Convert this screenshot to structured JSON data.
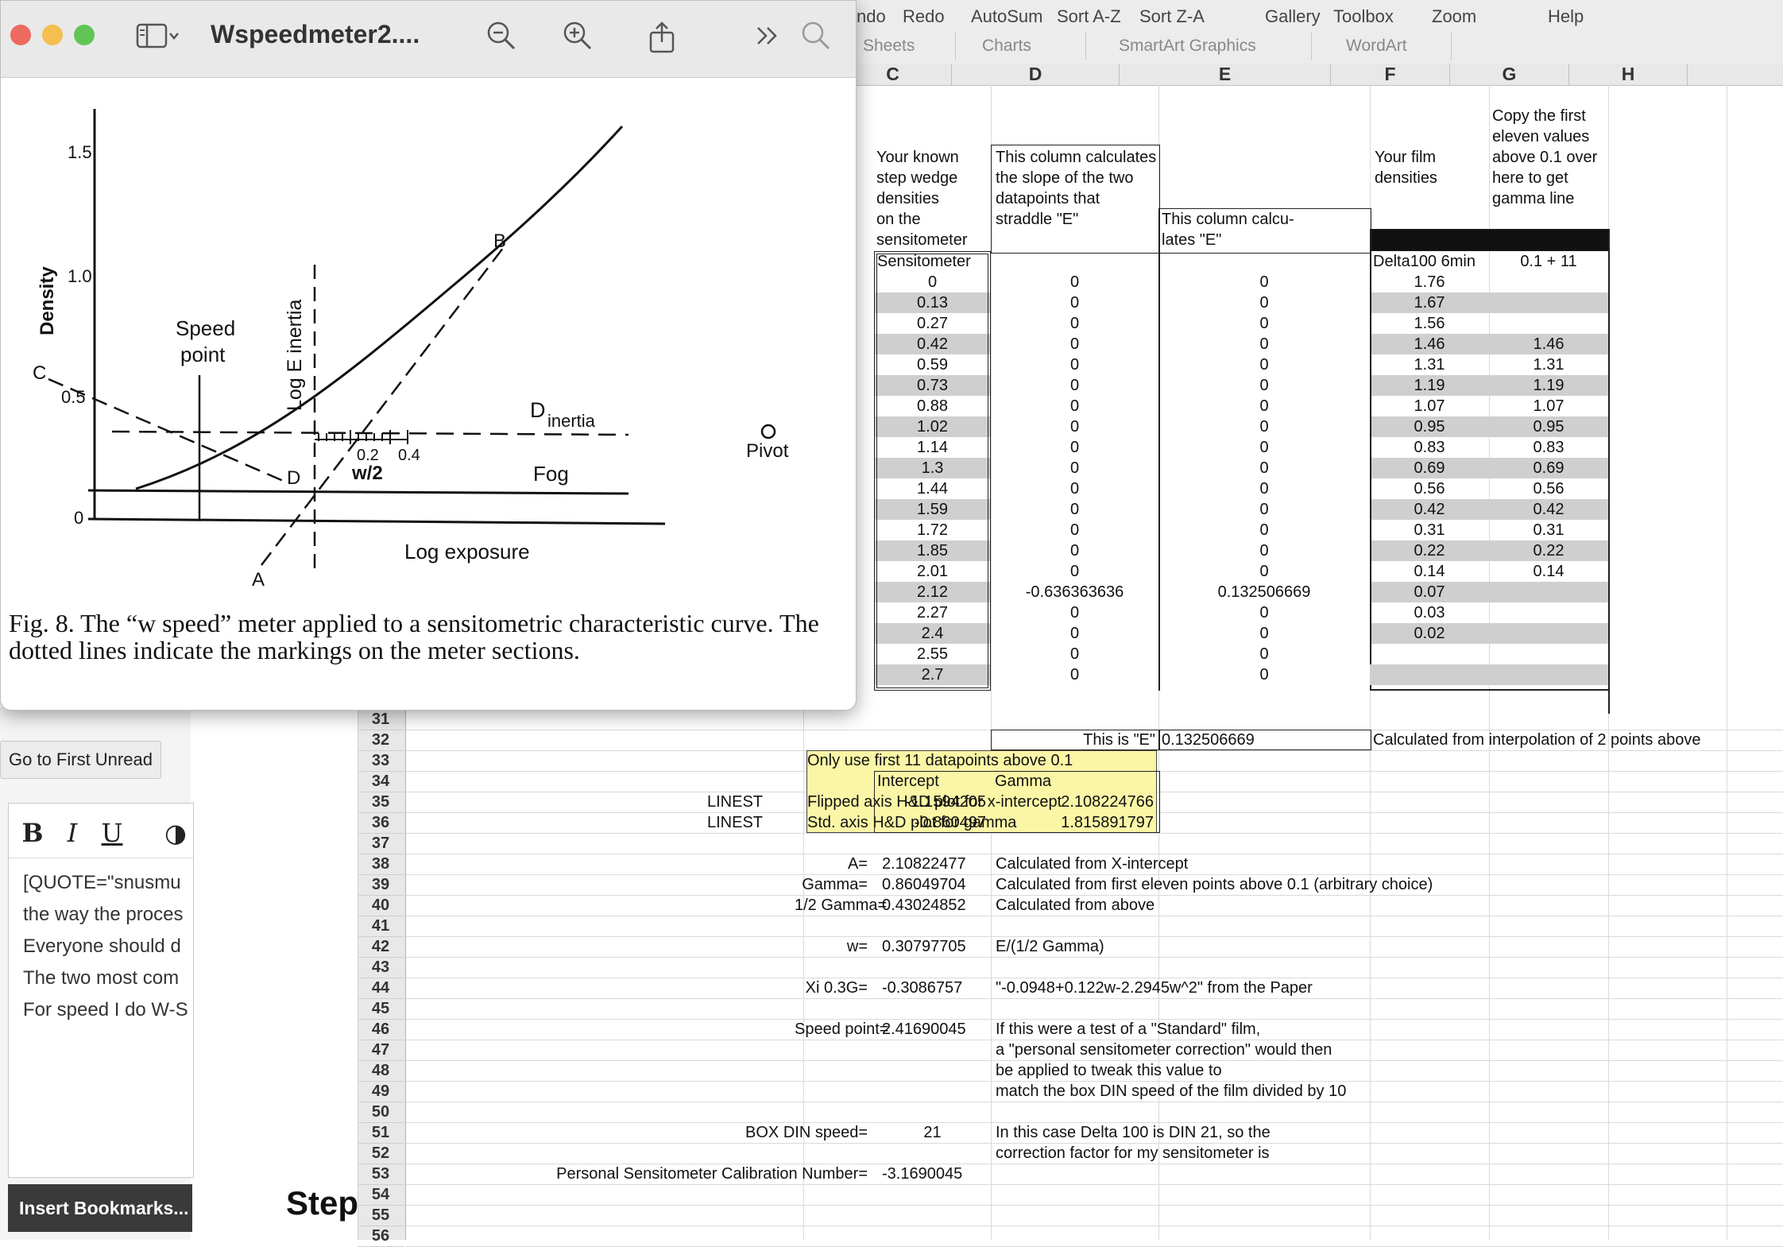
{
  "preview": {
    "title": "Wspeedmeter2....",
    "caption": "Fig. 8. The “w speed” meter applied to a sensitometric characteristic curve. The dotted lines indicate the markings on the meter sections.",
    "figure_labels": {
      "y_axis": "Density",
      "x_axis": "Log exposure",
      "speed_point": [
        "Speed",
        "point"
      ],
      "log_e_inertia": "Log E inertia",
      "d_inertia": "D",
      "d_inertia_sub": "inertia",
      "fog": "Fog",
      "pivot": "Pivot",
      "w_half": "w/2",
      "ticks_y": [
        "1.5",
        "1.0",
        "0.5",
        "0"
      ],
      "scale_ticks": [
        "0.2",
        "0.4"
      ],
      "points": [
        "A",
        "B",
        "C",
        "D"
      ]
    }
  },
  "forum": {
    "go_first_unread": "Go to First Unread",
    "editor_buttons": [
      "B",
      "I",
      "U",
      "◑"
    ],
    "lines": [
      "[QUOTE=\"snusmu",
      "the way the proces",
      "Everyone should d",
      "The two most com",
      "For speed I do W-S"
    ],
    "insert_bookmarks": "Insert Bookmarks...",
    "step": "Step"
  },
  "spreadsheet": {
    "toolbar": [
      "ndo",
      "Redo",
      "AutoSum",
      "Sort A-Z",
      "Sort Z-A",
      "Gallery",
      "Toolbox",
      "Zoom",
      "Help"
    ],
    "ribbon_tabs": [
      "Sheets",
      "Charts",
      "SmartArt Graphics",
      "WordArt"
    ],
    "columns": [
      "C",
      "D",
      "E",
      "F",
      "G",
      "H"
    ],
    "headers": {
      "c": [
        "Your known",
        "step wedge",
        "densities",
        "on the",
        "sensitometer"
      ],
      "d": [
        "This column calculates",
        "the slope of the two",
        "datapoints that",
        "straddle \"E\""
      ],
      "e": [
        "This column calcu-",
        "lates \"E\""
      ],
      "f": [
        "Your film",
        "densities"
      ],
      "g": [
        "Copy the first",
        "eleven values",
        "above 0.1 over",
        "here to get",
        "gamma line"
      ],
      "c_label": "Sensitometer",
      "f_label": "Delta100 6min",
      "g_label": "0.1 + 11"
    },
    "table": {
      "c": [
        "0",
        "0.13",
        "0.27",
        "0.42",
        "0.59",
        "0.73",
        "0.88",
        "1.02",
        "1.14",
        "1.3",
        "1.44",
        "1.59",
        "1.72",
        "1.85",
        "2.01",
        "2.12",
        "2.27",
        "2.4",
        "2.55",
        "2.7"
      ],
      "d": [
        "0",
        "0",
        "0",
        "0",
        "0",
        "0",
        "0",
        "0",
        "0",
        "0",
        "0",
        "0",
        "0",
        "0",
        "0",
        "-0.636363636",
        "0",
        "0",
        "0",
        "0"
      ],
      "e": [
        "0",
        "0",
        "0",
        "0",
        "0",
        "0",
        "0",
        "0",
        "0",
        "0",
        "0",
        "0",
        "0",
        "0",
        "0",
        "0.132506669",
        "0",
        "0",
        "0",
        "0"
      ],
      "f": [
        "1.76",
        "1.67",
        "1.56",
        "1.46",
        "1.31",
        "1.19",
        "1.07",
        "0.95",
        "0.83",
        "0.69",
        "0.56",
        "0.42",
        "0.31",
        "0.22",
        "0.14",
        "0.07",
        "0.03",
        "0.02",
        "",
        ""
      ],
      "g": [
        "",
        "",
        "",
        "1.46",
        "1.31",
        "1.19",
        "1.07",
        "0.95",
        "0.83",
        "0.69",
        "0.56",
        "0.42",
        "0.31",
        "0.22",
        "0.14",
        "",
        "",
        "",
        "",
        ""
      ]
    },
    "row_numbers": [
      "31",
      "32",
      "33",
      "34",
      "35",
      "36",
      "37",
      "38",
      "39",
      "40",
      "41",
      "42",
      "43",
      "44",
      "45",
      "46",
      "47",
      "48",
      "49",
      "50",
      "51",
      "52",
      "53",
      "54",
      "55",
      "56"
    ],
    "e_label": "This is \"E\"",
    "e_value": "0.132506669",
    "e_note": "Calculated from interpolation of 2 points above",
    "yellow": {
      "title": "Only use first 11 datapoints above 0.1",
      "intercept_head": "Intercept",
      "gamma_head": "Gamma",
      "row1_label": "Flipped axis H&D plot for x-intercept",
      "row1_fn": "LINEST",
      "row1_intercept": "-1.1594205",
      "row1_gamma": "2.108224766",
      "row2_label": "Std. axis H&D plot for gamma",
      "row2_fn": "LINEST",
      "row2_intercept": "-0.860497",
      "row2_gamma": "1.815891797"
    },
    "calc": [
      {
        "label": "A=",
        "value": "2.10822477",
        "note": "Calculated from X-intercept"
      },
      {
        "label": "Gamma=",
        "value": "0.86049704",
        "note": "Calculated from first eleven points above 0.1 (arbitrary choice)"
      },
      {
        "label": "1/2 Gamma=",
        "value": "0.43024852",
        "note": "Calculated from above"
      },
      {
        "label": "w=",
        "value": "0.30797705",
        "note": "E/(1/2 Gamma)"
      },
      {
        "label": "Xi 0.3G=",
        "value": "-0.3086757",
        "note": "\"-0.0948+0.122w-2.2945w^2\" from the Paper"
      },
      {
        "label": "Speed point=",
        "value": "2.41690045",
        "note": "If this were a test of a \"Standard\" film,"
      }
    ],
    "speed_notes": [
      " a \"personal sensitometer correction\" would then",
      " be applied to tweak this value to",
      "match the box DIN speed of the film divided by 10"
    ],
    "box_din_label": "BOX DIN speed=",
    "box_din_value": "21",
    "box_din_notes": [
      "In this case Delta 100 is DIN 21, so the",
      "correction factor for my sensitometer is"
    ],
    "personal_label": "Personal Sensitometer Calibration Number=",
    "personal_value": "-3.1690045"
  }
}
